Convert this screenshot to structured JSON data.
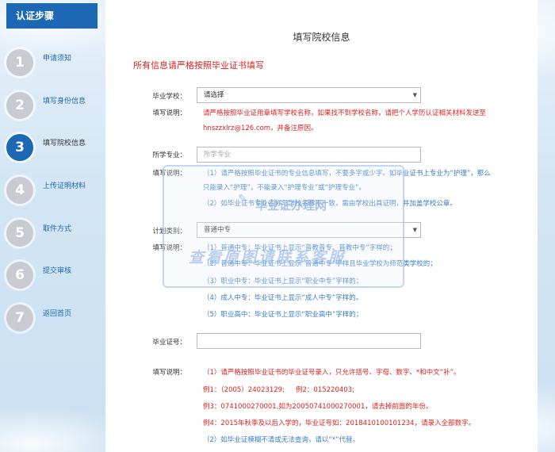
{
  "sidebar": {
    "header": "认证步骤",
    "steps": [
      {
        "num": "1",
        "label": "申请须知"
      },
      {
        "num": "2",
        "label": "填写身份信息"
      },
      {
        "num": "3",
        "label": "填写院校信息"
      },
      {
        "num": "4",
        "label": "上传证明材料"
      },
      {
        "num": "5",
        "label": "取件方式"
      },
      {
        "num": "6",
        "label": "提交审核"
      },
      {
        "num": "7",
        "label": "返回首页"
      }
    ],
    "active_index": 2
  },
  "main": {
    "title": "填写院校信息",
    "notice": "所有信息请严格按照毕业证书填写",
    "school": {
      "label": "毕业学校：",
      "value": "请选择",
      "help_label": "填写说明：",
      "help_line1": "请严格按照毕业证用章填写学校名称，如果找不到学校名称，请把个人学历认证相关材料发送至",
      "help_line2": "hnszzxlrz@126.com，并备注原因。"
    },
    "major": {
      "label": "所学专业：",
      "placeholder": "所学专业",
      "help_label": "填写说明：",
      "help_line1": "（1）请严格按照毕业证书的专业信息填写，不要多字或少字。如毕业证书上专业为“护理”，那么",
      "help_line2": "只能录入“护理”，不能录入“护理专业”或“护理专业”。",
      "help_line3": "（2）如毕业证书专业名称与学校名称不一致，需由学校出具证明，并加盖学校公章。"
    },
    "plan": {
      "label": "计划类别：",
      "value": "普通中专",
      "help_label": "填写说明：",
      "help": [
        "（1）普通中专：毕业证书上显示“普教普专、普教中专”字样的；",
        "（2）普通中专：毕业证书上显示“普通中专”字样且毕业学校为师范类学校的；",
        "（3）职业中专：毕业证书上显示“职业中专”字样的；",
        "（4）成人中专：毕业证书上显示“成人中专”字样的。",
        "（5）职业高中：毕业证书上显示“职业高中”字样的；"
      ]
    },
    "cert": {
      "label": "毕业证号：",
      "value": "",
      "help_label": "填写说明：",
      "help1": "（1）请严格按照毕业证书的毕业证号录入，只允许括号、字母、数字、*和中文“补”。",
      "ex1a": "例1：（2005）24023129;",
      "ex1b": "例2：015220403;",
      "ex3": "例3：0741000270001,如为20050741000270001，请去掉前面的年份。",
      "ex4": "例4：2015年秋季及以后入学的，毕业证号如：2018410100101234，请录入全部数字。",
      "help2": "（2）如毕业证模糊不清或无法查询，请以“*”代替。"
    }
  },
  "watermark": {
    "line1": "毕业证办理网",
    "line2": "查看原图请联系客服"
  }
}
